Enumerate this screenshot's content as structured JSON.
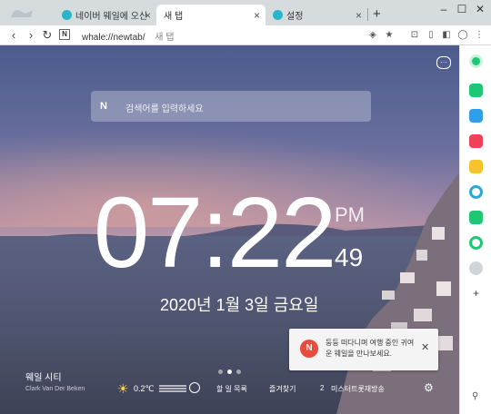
{
  "tabs": [
    {
      "title": "네이버 웨일에 오신 것을 환",
      "active": false
    },
    {
      "title": "새 탭",
      "active": true
    },
    {
      "title": "설정",
      "active": false
    }
  ],
  "address": {
    "url_scheme": "whale://newtab/",
    "page_title": "새 탭"
  },
  "search": {
    "logo": "N",
    "placeholder": "검색어를 입력하세요"
  },
  "clock": {
    "hours": "07",
    "minutes": "22",
    "ampm": "PM",
    "seconds": "49",
    "date": "2020년 1월 3일 금요일"
  },
  "background": {
    "location": "웨일 시티",
    "credit": "Clark Van Der Beken"
  },
  "weather": {
    "temperature": "0.2℃"
  },
  "bottom_links": {
    "todo": "할 일 목록",
    "favorites": "즐겨찾기",
    "broadcast_count": "2",
    "broadcast": "미스터트롯재방송"
  },
  "notification": {
    "badge": "N",
    "message": "둥둥 떠다니며 여행 중인 귀여운 웨일을 만나보세요."
  },
  "colors": {
    "accent_green": "#1ec773",
    "notif_red": "#e74c3c"
  }
}
